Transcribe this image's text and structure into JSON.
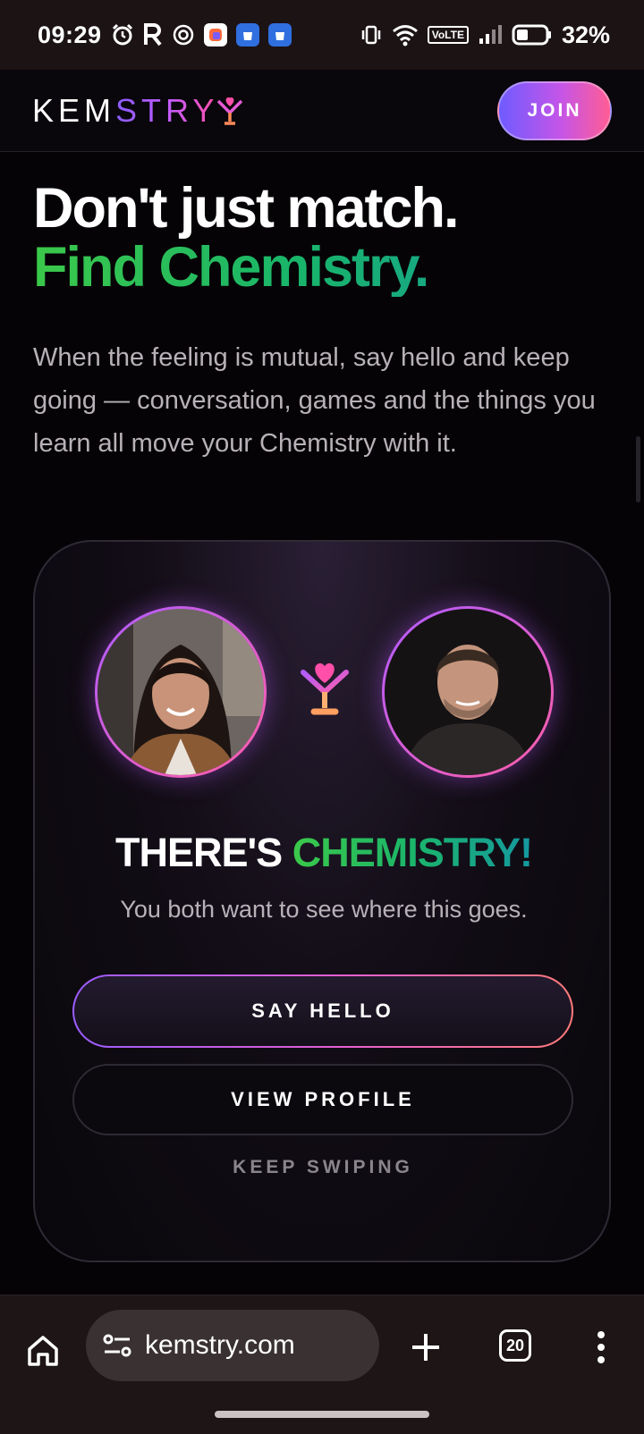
{
  "status_bar": {
    "time": "09:29",
    "volte": "VoLTE",
    "battery": "32%",
    "icons": [
      "alarm-icon",
      "r-app-icon",
      "openai-icon",
      "app-icon",
      "app-store-icon",
      "app-store-icon",
      "vibrate-icon",
      "wifi-icon",
      "volte-icon",
      "signal-icon",
      "battery-icon"
    ]
  },
  "header": {
    "logo_left": "KEM",
    "logo_right": "STRY",
    "join_label": "JOIN"
  },
  "hero": {
    "headline_1": "Don't just match.",
    "headline_2": "Find Chemistry.",
    "subtext": "When the feeling is mutual, say hello and keep going — conversation, games and the things you learn all move your Chemistry with it."
  },
  "match_card": {
    "title_white": "THERE'S ",
    "title_gradient": "CHEMISTRY!",
    "subtitle": "You both want to see where this goes.",
    "say_hello_label": "SAY HELLO",
    "view_profile_label": "VIEW PROFILE",
    "keep_swiping_label": "KEEP SWIPING"
  },
  "browser": {
    "url": "kemstry.com",
    "tab_count": "20"
  },
  "colors": {
    "accent_purple": "#9b5cff",
    "accent_pink": "#ff5ea8",
    "accent_green": "#3bc84a",
    "accent_teal": "#1497a0",
    "background": "#050306"
  }
}
